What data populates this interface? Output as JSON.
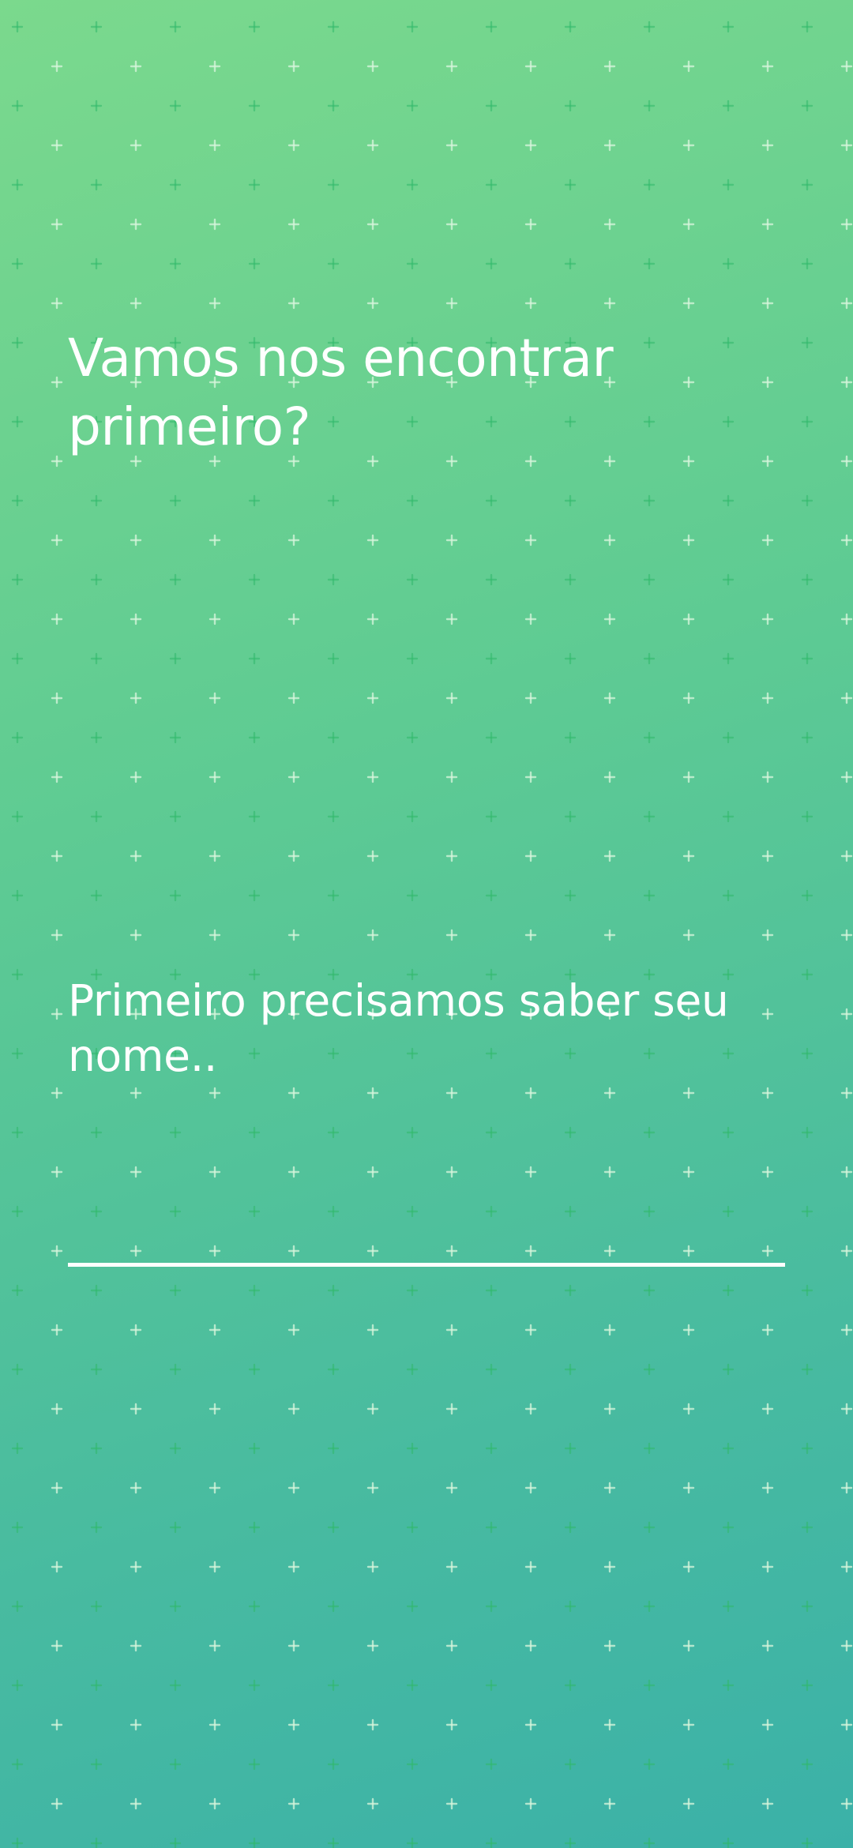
{
  "onboarding": {
    "title": "Vamos nos encontrar primeiro?",
    "prompt": "Primeiro precisamos saber seu nome..",
    "name_input": {
      "value": "",
      "placeholder": ""
    }
  },
  "theme": {
    "gradient_start": "#7bd98d",
    "gradient_end": "#3bb1a8",
    "pattern_icon": "plus-pattern",
    "text_color": "#ffffff"
  }
}
